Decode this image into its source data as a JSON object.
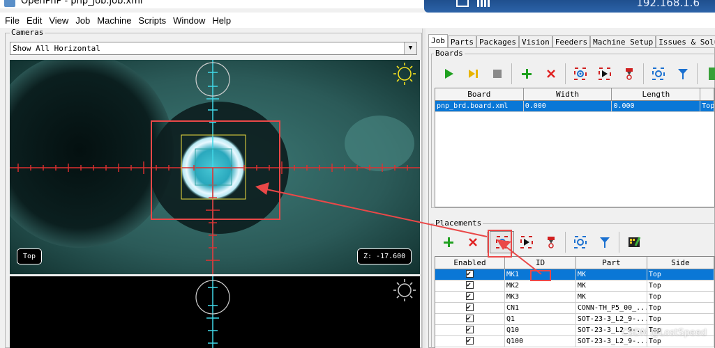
{
  "window": {
    "title": "OpenPnP - pnp_job.job.xml",
    "remote_host": "192.168.1.6"
  },
  "menu": [
    "File",
    "Edit",
    "View",
    "Job",
    "Machine",
    "Scripts",
    "Window",
    "Help"
  ],
  "cameras": {
    "legend": "Cameras",
    "layout_select": "Show All Horizontal",
    "top_camera_label": "Top",
    "z_readout": "Z: -17.600"
  },
  "tabs": [
    "Job",
    "Parts",
    "Packages",
    "Vision",
    "Feeders",
    "Machine Setup",
    "Issues & Soluti"
  ],
  "boards": {
    "legend": "Boards",
    "toolbar": [
      "start-job-icon",
      "step-job-icon",
      "stop-job-icon",
      "add-board-icon",
      "remove-board-icon",
      "position-camera-board-icon",
      "position-board-location-icon",
      "move-nozzle-board-icon",
      "capture-camera-board-icon",
      "capture-nozzle-board-icon",
      "panel-icon"
    ],
    "columns": [
      "Board",
      "Width",
      "Length",
      ""
    ],
    "rows": [
      {
        "board": "pnp_brd.board.xml",
        "width": "0.000",
        "length": "0.000",
        "side": "Top"
      }
    ]
  },
  "placements": {
    "legend": "Placements",
    "toolbar": [
      "add-placement-icon",
      "remove-placement-icon",
      "position-camera-icon",
      "position-nozzle-icon",
      "move-nozzle-icon",
      "capture-camera-icon",
      "capture-tool-icon",
      "edit-feeder-icon"
    ],
    "columns": [
      "Enabled",
      "ID",
      "Part",
      "Side"
    ],
    "rows": [
      {
        "id": "MK1",
        "part": "MK",
        "side": "Top"
      },
      {
        "id": "MK2",
        "part": "MK",
        "side": "Top"
      },
      {
        "id": "MK3",
        "part": "MK",
        "side": "Top"
      },
      {
        "id": "CN1",
        "part": "CONN-TH_P5_00_...",
        "side": "Top"
      },
      {
        "id": "Q1",
        "part": "SOT-23-3_L2_9-...",
        "side": "Top"
      },
      {
        "id": "Q10",
        "part": "SOT-23-3_L2_9-...",
        "side": "Top"
      },
      {
        "id": "Q100",
        "part": "SOT-23-3_L2_9-...",
        "side": "Top"
      }
    ]
  },
  "watermark": "CSDN @LostSpeed",
  "colors": {
    "selection": "#0a77d6",
    "annotation": "#ea4848",
    "crosshair_red": "#e03030",
    "crosshair_cyan": "#40d8e8"
  }
}
